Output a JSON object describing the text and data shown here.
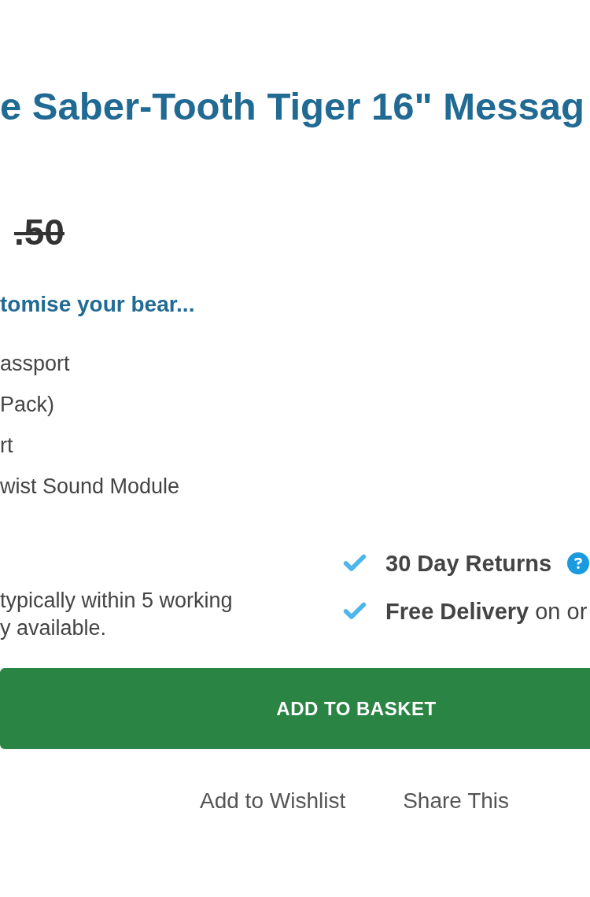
{
  "product": {
    "title": "e Saber-Tooth Tiger 16\" Messag",
    "old_price": ".50"
  },
  "customise": {
    "heading": "tomise your bear...",
    "options": [
      "assport",
      "Pack)",
      "rt",
      "wist Sound Module"
    ]
  },
  "delivery": {
    "lines": [
      "typically within 5 working",
      "y available."
    ]
  },
  "benefits": [
    {
      "kind": "heading",
      "text": "30 Day Returns",
      "help": true
    },
    {
      "kind": "note",
      "text": "**Free Delivery** on or",
      "help": false
    }
  ],
  "actions": {
    "button": "ADD TO BASKET",
    "links": [
      "Add to Wishlist",
      "Share This"
    ]
  }
}
